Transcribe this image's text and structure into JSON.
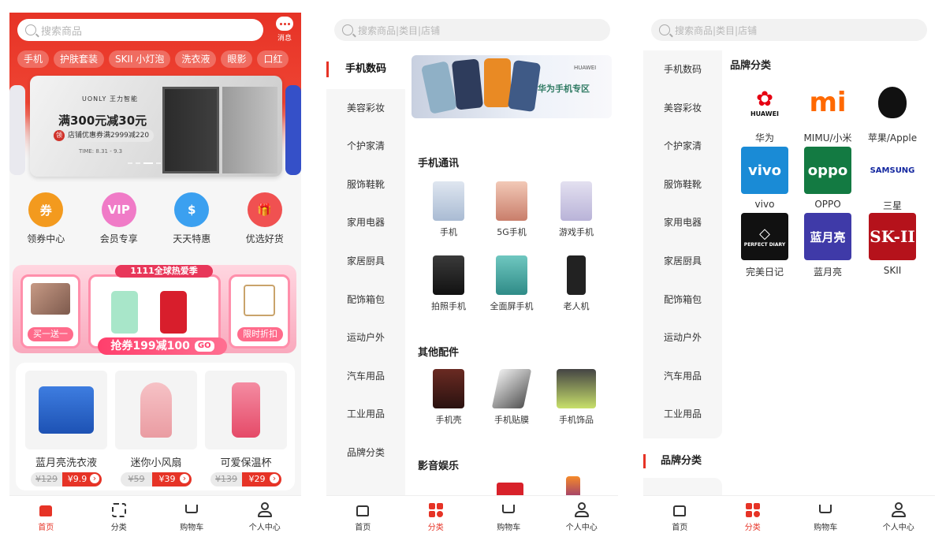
{
  "home": {
    "search_placeholder": "搜索商品",
    "message_label": "消息",
    "chips": [
      "手机",
      "护肤套装",
      "SKII 小灯泡",
      "洗衣液",
      "眼影",
      "口红"
    ],
    "banner": {
      "brand": "UONLY 王力智能",
      "promo": "满300元减30元",
      "coupon": "店铺优惠券满2999减220",
      "time": "TIME: 8.31 - 9.3"
    },
    "quick_entries": [
      {
        "label": "领券中心",
        "icon": "coupon-icon",
        "color": "#f39a1e"
      },
      {
        "label": "会员专享",
        "icon": "vip-icon",
        "color": "#f07bc7"
      },
      {
        "label": "天天特惠",
        "icon": "money-icon",
        "color": "#3ba0f0"
      },
      {
        "label": "优选好货",
        "icon": "gift-icon",
        "color": "#f05151"
      }
    ],
    "promo": {
      "headline": "1111全球热爱季",
      "left_tag": "买一送一",
      "center": "抢券199减100",
      "go": "GO",
      "right_tag": "限时折扣"
    },
    "goods": [
      {
        "name": "蓝月亮洗衣液",
        "old_price": "¥129",
        "price": "¥9.9"
      },
      {
        "name": "迷你小风扇",
        "old_price": "¥59",
        "price": "¥39"
      },
      {
        "name": "可爱保温杯",
        "old_price": "¥139",
        "price": "¥29"
      }
    ]
  },
  "category": {
    "search_placeholder": "搜索商品|类目|店铺",
    "sidebar": [
      "手机数码",
      "美容彩妆",
      "个护家清",
      "服饰鞋靴",
      "家用电器",
      "家居厨具",
      "配饰箱包",
      "运动户外",
      "汽车用品",
      "工业用品",
      "品牌分类"
    ],
    "banner": {
      "brand": "HUAWEI",
      "text": "华为手机专区"
    },
    "sections": [
      {
        "title": "手机通讯",
        "items": [
          "手机",
          "5G手机",
          "游戏手机",
          "拍照手机",
          "全面屏手机",
          "老人机"
        ]
      },
      {
        "title": "其他配件",
        "items": [
          "手机壳",
          "手机贴膜",
          "手机饰品"
        ]
      },
      {
        "title": "影音娱乐",
        "items": []
      }
    ]
  },
  "brands": {
    "search_placeholder": "搜索商品|类目|店铺",
    "sidebar": [
      "手机数码",
      "美容彩妆",
      "个护家清",
      "服饰鞋靴",
      "家用电器",
      "家居厨具",
      "配饰箱包",
      "运动户外",
      "汽车用品",
      "工业用品"
    ],
    "sidebar_selected": "品牌分类",
    "title": "品牌分类",
    "list": [
      {
        "name": "华为",
        "logo": "HUAWEI",
        "color": "#ffffff",
        "fg": "#e60012"
      },
      {
        "name": "MIMU/小米",
        "logo": "mi",
        "color": "#ffffff",
        "fg": "#ff6900"
      },
      {
        "name": "苹果/Apple",
        "logo": "",
        "color": "#ffffff",
        "fg": "#111111"
      },
      {
        "name": "vivo",
        "logo": "vivo",
        "color": "#1a8bd6",
        "fg": "#ffffff"
      },
      {
        "name": "OPPO",
        "logo": "oppo",
        "color": "#137a42",
        "fg": "#ffffff"
      },
      {
        "name": "三星",
        "logo": "SAMSUNG",
        "color": "#ffffff",
        "fg": "#1428a0"
      },
      {
        "name": "完美日记",
        "logo": "PERFECT DIARY",
        "color": "#111111",
        "fg": "#ffffff"
      },
      {
        "name": "蓝月亮",
        "logo": "蓝月亮",
        "color": "#3f3aa8",
        "fg": "#ffffff"
      },
      {
        "name": "SKII",
        "logo": "SK-II",
        "color": "#b5121b",
        "fg": "#ffffff"
      }
    ]
  },
  "tabbar": [
    "首页",
    "分类",
    "购物车",
    "个人中心"
  ],
  "colors": {
    "accent": "#e63326"
  }
}
